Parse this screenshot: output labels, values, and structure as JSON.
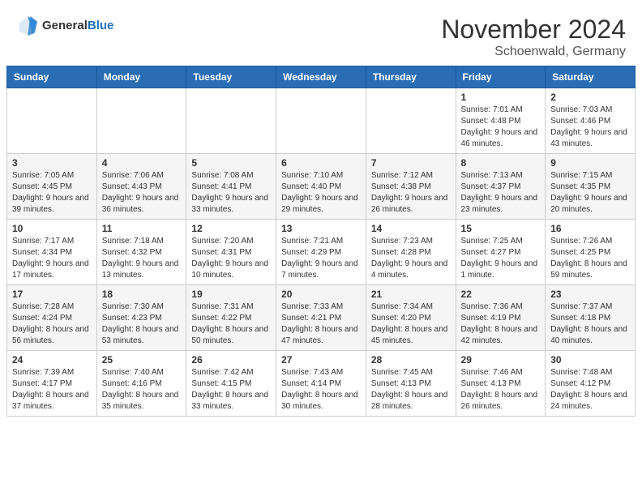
{
  "header": {
    "logo_general": "General",
    "logo_blue": "Blue",
    "month_title": "November 2024",
    "location": "Schoenwald, Germany"
  },
  "weekdays": [
    "Sunday",
    "Monday",
    "Tuesday",
    "Wednesday",
    "Thursday",
    "Friday",
    "Saturday"
  ],
  "rows": [
    [
      {
        "day": "",
        "info": ""
      },
      {
        "day": "",
        "info": ""
      },
      {
        "day": "",
        "info": ""
      },
      {
        "day": "",
        "info": ""
      },
      {
        "day": "",
        "info": ""
      },
      {
        "day": "1",
        "info": "Sunrise: 7:01 AM\nSunset: 4:48 PM\nDaylight: 9 hours and 46 minutes."
      },
      {
        "day": "2",
        "info": "Sunrise: 7:03 AM\nSunset: 4:46 PM\nDaylight: 9 hours and 43 minutes."
      }
    ],
    [
      {
        "day": "3",
        "info": "Sunrise: 7:05 AM\nSunset: 4:45 PM\nDaylight: 9 hours and 39 minutes."
      },
      {
        "day": "4",
        "info": "Sunrise: 7:06 AM\nSunset: 4:43 PM\nDaylight: 9 hours and 36 minutes."
      },
      {
        "day": "5",
        "info": "Sunrise: 7:08 AM\nSunset: 4:41 PM\nDaylight: 9 hours and 33 minutes."
      },
      {
        "day": "6",
        "info": "Sunrise: 7:10 AM\nSunset: 4:40 PM\nDaylight: 9 hours and 29 minutes."
      },
      {
        "day": "7",
        "info": "Sunrise: 7:12 AM\nSunset: 4:38 PM\nDaylight: 9 hours and 26 minutes."
      },
      {
        "day": "8",
        "info": "Sunrise: 7:13 AM\nSunset: 4:37 PM\nDaylight: 9 hours and 23 minutes."
      },
      {
        "day": "9",
        "info": "Sunrise: 7:15 AM\nSunset: 4:35 PM\nDaylight: 9 hours and 20 minutes."
      }
    ],
    [
      {
        "day": "10",
        "info": "Sunrise: 7:17 AM\nSunset: 4:34 PM\nDaylight: 9 hours and 17 minutes."
      },
      {
        "day": "11",
        "info": "Sunrise: 7:18 AM\nSunset: 4:32 PM\nDaylight: 9 hours and 13 minutes."
      },
      {
        "day": "12",
        "info": "Sunrise: 7:20 AM\nSunset: 4:31 PM\nDaylight: 9 hours and 10 minutes."
      },
      {
        "day": "13",
        "info": "Sunrise: 7:21 AM\nSunset: 4:29 PM\nDaylight: 9 hours and 7 minutes."
      },
      {
        "day": "14",
        "info": "Sunrise: 7:23 AM\nSunset: 4:28 PM\nDaylight: 9 hours and 4 minutes."
      },
      {
        "day": "15",
        "info": "Sunrise: 7:25 AM\nSunset: 4:27 PM\nDaylight: 9 hours and 1 minute."
      },
      {
        "day": "16",
        "info": "Sunrise: 7:26 AM\nSunset: 4:25 PM\nDaylight: 8 hours and 59 minutes."
      }
    ],
    [
      {
        "day": "17",
        "info": "Sunrise: 7:28 AM\nSunset: 4:24 PM\nDaylight: 8 hours and 56 minutes."
      },
      {
        "day": "18",
        "info": "Sunrise: 7:30 AM\nSunset: 4:23 PM\nDaylight: 8 hours and 53 minutes."
      },
      {
        "day": "19",
        "info": "Sunrise: 7:31 AM\nSunset: 4:22 PM\nDaylight: 8 hours and 50 minutes."
      },
      {
        "day": "20",
        "info": "Sunrise: 7:33 AM\nSunset: 4:21 PM\nDaylight: 8 hours and 47 minutes."
      },
      {
        "day": "21",
        "info": "Sunrise: 7:34 AM\nSunset: 4:20 PM\nDaylight: 8 hours and 45 minutes."
      },
      {
        "day": "22",
        "info": "Sunrise: 7:36 AM\nSunset: 4:19 PM\nDaylight: 8 hours and 42 minutes."
      },
      {
        "day": "23",
        "info": "Sunrise: 7:37 AM\nSunset: 4:18 PM\nDaylight: 8 hours and 40 minutes."
      }
    ],
    [
      {
        "day": "24",
        "info": "Sunrise: 7:39 AM\nSunset: 4:17 PM\nDaylight: 8 hours and 37 minutes."
      },
      {
        "day": "25",
        "info": "Sunrise: 7:40 AM\nSunset: 4:16 PM\nDaylight: 8 hours and 35 minutes."
      },
      {
        "day": "26",
        "info": "Sunrise: 7:42 AM\nSunset: 4:15 PM\nDaylight: 8 hours and 33 minutes."
      },
      {
        "day": "27",
        "info": "Sunrise: 7:43 AM\nSunset: 4:14 PM\nDaylight: 8 hours and 30 minutes."
      },
      {
        "day": "28",
        "info": "Sunrise: 7:45 AM\nSunset: 4:13 PM\nDaylight: 8 hours and 28 minutes."
      },
      {
        "day": "29",
        "info": "Sunrise: 7:46 AM\nSunset: 4:13 PM\nDaylight: 8 hours and 26 minutes."
      },
      {
        "day": "30",
        "info": "Sunrise: 7:48 AM\nSunset: 4:12 PM\nDaylight: 8 hours and 24 minutes."
      }
    ]
  ]
}
